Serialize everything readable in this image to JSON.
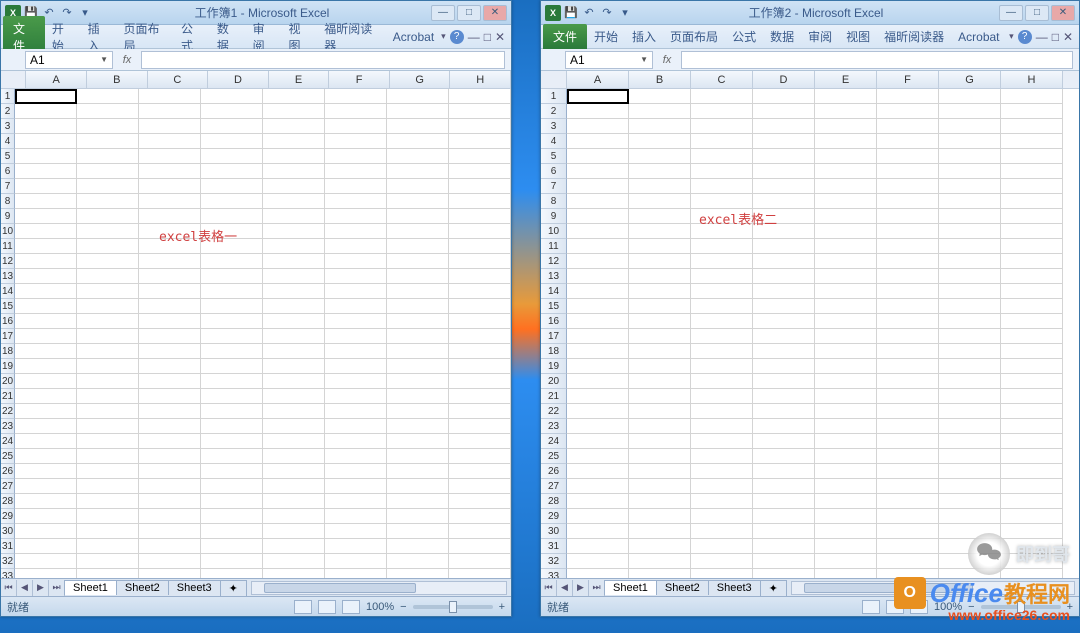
{
  "left_window": {
    "title": "工作簿1 - Microsoft Excel",
    "file_tab": "文件",
    "ribbon_tabs": [
      "开始",
      "插入",
      "页面布局",
      "公式",
      "数据",
      "审阅",
      "视图",
      "福昕阅读器",
      "Acrobat"
    ],
    "namebox": "A1",
    "fx_label": "fx",
    "columns": [
      "A",
      "B",
      "C",
      "D",
      "E",
      "F",
      "G",
      "H"
    ],
    "rows": [
      "1",
      "2",
      "3",
      "4",
      "5",
      "6",
      "7",
      "8",
      "9",
      "10",
      "11",
      "12",
      "13",
      "14",
      "15",
      "16",
      "17",
      "18",
      "19",
      "20",
      "21",
      "22",
      "23",
      "24",
      "25",
      "26",
      "27",
      "28",
      "29",
      "30",
      "31",
      "32",
      "33"
    ],
    "cell_text": "excel表格一",
    "sheets": [
      "Sheet1",
      "Sheet2",
      "Sheet3"
    ],
    "status": "就绪",
    "zoom": "100%"
  },
  "right_window": {
    "title": "工作簿2 - Microsoft Excel",
    "file_tab": "文件",
    "ribbon_tabs": [
      "开始",
      "插入",
      "页面布局",
      "公式",
      "数据",
      "审阅",
      "视图",
      "福昕阅读器",
      "Acrobat"
    ],
    "namebox": "A1",
    "fx_label": "fx",
    "columns": [
      "A",
      "B",
      "C",
      "D",
      "E",
      "F",
      "G",
      "H"
    ],
    "rows": [
      "1",
      "2",
      "3",
      "4",
      "5",
      "6",
      "7",
      "8",
      "9",
      "10",
      "11",
      "12",
      "13",
      "14",
      "15",
      "16",
      "17",
      "18",
      "19",
      "20",
      "21",
      "22",
      "23",
      "24",
      "25",
      "26",
      "27",
      "28",
      "29",
      "30",
      "31",
      "32",
      "33"
    ],
    "cell_text": "excel表格二",
    "sheets": [
      "Sheet1",
      "Sheet2",
      "Sheet3"
    ],
    "status": "就绪",
    "zoom": "100%"
  },
  "watermark": {
    "wechat_text": "即到哥",
    "brand_office": "Office",
    "brand_cn": "教程网",
    "url": "www.office26.com"
  }
}
